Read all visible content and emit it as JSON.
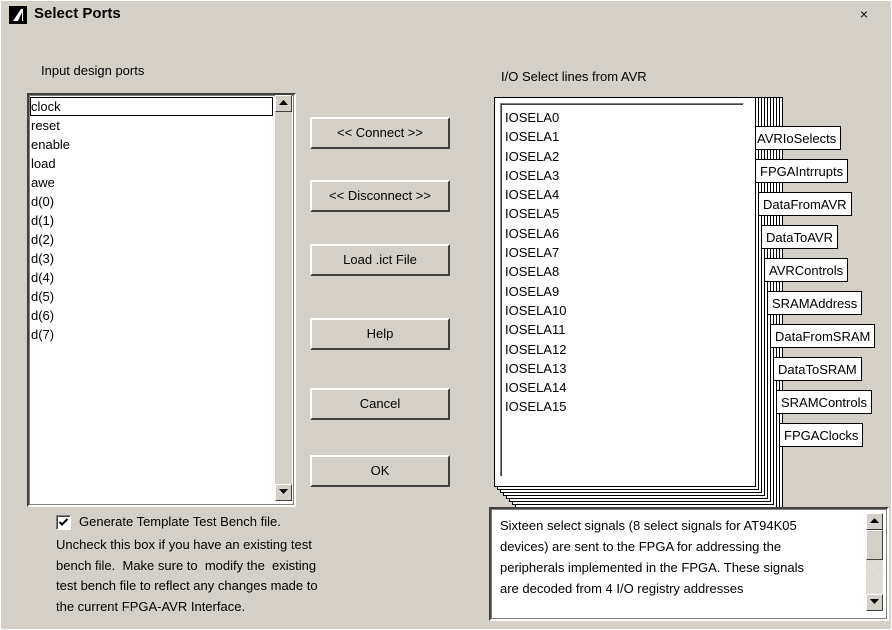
{
  "window": {
    "title": "Select Ports",
    "close_glyph": "×"
  },
  "left": {
    "label": "Input design ports",
    "ports": [
      "clock",
      "reset",
      "enable",
      "load",
      "awe",
      "d(0)",
      "d(1)",
      "d(2)",
      "d(3)",
      "d(4)",
      "d(5)",
      "d(6)",
      "d(7)"
    ],
    "selected": "clock"
  },
  "buttons": {
    "connect": "<< Connect >>",
    "disconnect": "<< Disconnect >>",
    "load": "Load .ict File",
    "help": "Help",
    "cancel": "Cancel",
    "ok": "OK"
  },
  "right": {
    "label": "I/O Select lines from AVR",
    "lines": [
      "IOSELA0",
      "IOSELA1",
      "IOSELA2",
      "IOSELA3",
      "IOSELA4",
      "IOSELA5",
      "IOSELA6",
      "IOSELA7",
      "IOSELA8",
      "IOSELA9",
      "IOSELA10",
      "IOSELA11",
      "IOSELA12",
      "IOSELA13",
      "IOSELA14",
      "IOSELA15"
    ],
    "tabs": [
      "AVRIoSelects",
      "FPGAIntrrupts",
      "DataFromAVR",
      "DataToAVR",
      "AVRControls",
      "SRAMAddress",
      "DataFromSRAM",
      "DataToSRAM",
      "SRAMControls",
      "FPGAClocks"
    ],
    "active_tab": "AVRIoSelects"
  },
  "testbench": {
    "checked": true,
    "checkbox_label": "Generate Template Test Bench file.",
    "help_lines": [
      "Uncheck this box if you have an existing test",
      "bench file.  Make sure to  modify the  existing",
      "test bench file to reflect any changes made to",
      "the current FPGA-AVR Interface."
    ]
  },
  "description": {
    "lines": [
      "Sixteen select signals (8 select signals for AT94K05",
      "devices) are sent to the FPGA for addressing the",
      "peripherals implemented in the FPGA. These signals",
      "are decoded from 4 I/O registry addresses"
    ]
  }
}
